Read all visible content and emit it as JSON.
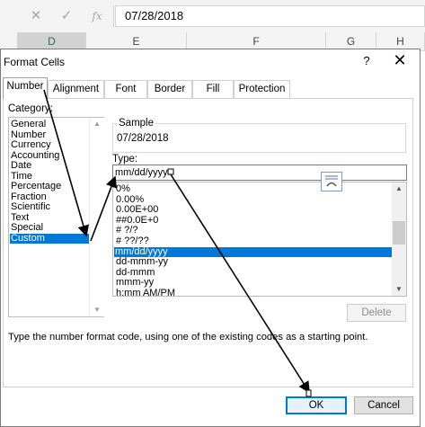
{
  "formula_bar": {
    "value": "07/28/2018",
    "fx_label": "fx"
  },
  "columns": [
    "D",
    "E",
    "F",
    "G",
    "H"
  ],
  "dialog": {
    "title": "Format Cells",
    "help": "?",
    "close": "✕",
    "tabs": [
      "Number",
      "Alignment",
      "Font",
      "Border",
      "Fill",
      "Protection"
    ],
    "category_label": "Category:",
    "categories": [
      "General",
      "Number",
      "Currency",
      "Accounting",
      "Date",
      "Time",
      "Percentage",
      "Fraction",
      "Scientific",
      "Text",
      "Special",
      "Custom"
    ],
    "selected_category": "Custom",
    "sample_label": "Sample",
    "sample_value": "07/28/2018",
    "type_label": "Type:",
    "type_value": "mm/dd/yyyy",
    "type_list": [
      "0%",
      "0.00%",
      "0.00E+00",
      "##0.0E+0",
      "# ?/?",
      "# ??/??",
      "mm/dd/yyyy",
      "dd-mmm-yy",
      "dd-mmm",
      "mmm-yy",
      "h:mm AM/PM"
    ],
    "selected_type": "mm/dd/yyyy",
    "delete_label": "Delete",
    "hint": "Type the number format code, using one of the existing codes as a starting point.",
    "ok_label": "OK",
    "cancel_label": "Cancel"
  },
  "colors": {
    "accent": "#0078d7",
    "excel_green": "#217346"
  }
}
